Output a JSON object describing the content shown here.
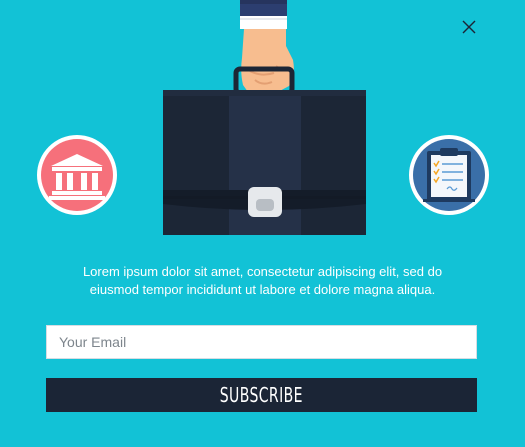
{
  "popup": {
    "message_line1": "Lorem ipsum dolor sit amet, consectetur adipiscing elit, sed do",
    "message_line2": "eiusmod tempor incididunt ut labore et dolore magna aliqua.",
    "email_placeholder": "Your Email",
    "email_value": "",
    "subscribe_label": "SUBSCRIBE"
  },
  "icons": {
    "close": "close-icon",
    "bank": "bank-icon",
    "clipboard": "clipboard-icon",
    "briefcase": "briefcase-icon",
    "hand": "hand-icon"
  },
  "colors": {
    "background": "#12c2d6",
    "button": "#1b2536",
    "bank_circle": "#f6707b",
    "clipboard_circle": "#3a6fa8",
    "briefcase": "#1c2636"
  }
}
